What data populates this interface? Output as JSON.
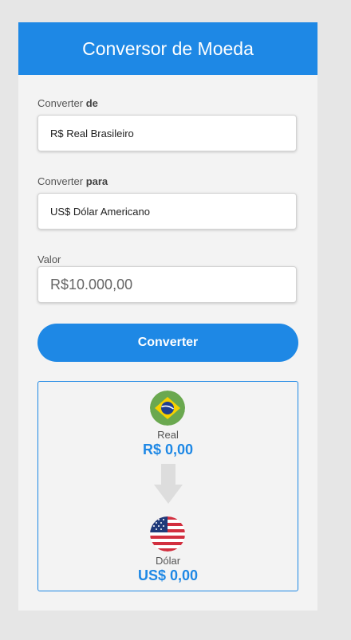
{
  "header": {
    "title": "Conversor de Moeda"
  },
  "form": {
    "from": {
      "label_prefix": "Converter ",
      "label_bold": "de",
      "selected": "R$ Real Brasileiro"
    },
    "to": {
      "label_prefix": "Converter ",
      "label_bold": "para",
      "selected": "US$ Dólar Americano"
    },
    "amount": {
      "label": "Valor",
      "placeholder": "R$10.000,00",
      "value": ""
    },
    "submit_label": "Converter"
  },
  "result": {
    "from": {
      "name": "Real",
      "amount": "R$ 0,00",
      "icon": "brazil-flag-icon"
    },
    "to": {
      "name": "Dólar",
      "amount": "US$ 0,00",
      "icon": "usa-flag-icon"
    }
  },
  "colors": {
    "accent": "#1e88e5",
    "card_bg": "#f3f3f3",
    "page_bg": "#e6e6e6"
  }
}
